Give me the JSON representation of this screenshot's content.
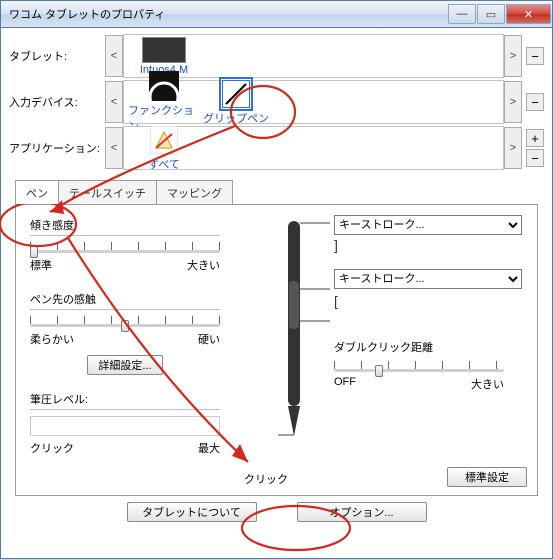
{
  "window": {
    "title": "ワコム タブレットのプロパティ"
  },
  "selectors": {
    "tablet": {
      "label": "タブレット:",
      "items": [
        "Intuos4 M"
      ]
    },
    "tool": {
      "label": "入力デバイス:",
      "items": [
        "ファンクション",
        "グリップペン"
      ]
    },
    "application": {
      "label": "アプリケーション:",
      "items": [
        "すべて"
      ]
    }
  },
  "tabs": [
    "ペン",
    "テールスイッチ",
    "マッピング"
  ],
  "pen": {
    "tilt": {
      "label": "傾き感度",
      "min": "標準",
      "max": "大きい"
    },
    "tip": {
      "label": "ペン先の感触",
      "min": "柔らかい",
      "max": "硬い"
    },
    "advanced_button": "詳細設定...",
    "pressure": {
      "label": "筆圧レベル:",
      "min": "クリック",
      "max": "最大"
    },
    "click_label": "クリック",
    "upper_button": {
      "selected": "キーストローク..."
    },
    "lower_button": {
      "selected": "キーストローク..."
    },
    "double_click": {
      "label": "ダブルクリック距離",
      "min": "OFF",
      "max": "大きい"
    },
    "default_button": "標準設定"
  },
  "footer": {
    "about": "タブレットについて",
    "options": "オプション..."
  }
}
